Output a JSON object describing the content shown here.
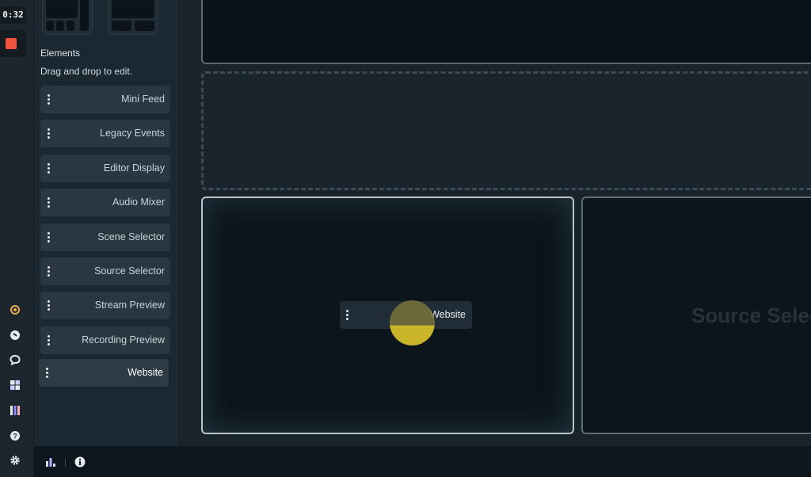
{
  "rail": {
    "timer": "0:32",
    "record_button": "stop-recording",
    "icons": [
      {
        "name": "prime-icon",
        "color": "#f0a94a"
      },
      {
        "name": "dashboard-icon",
        "color": "#e6ebf0"
      },
      {
        "name": "chat-icon",
        "color": "#e6ebf0"
      },
      {
        "name": "layout-editor-icon",
        "color": "#c8d0ff"
      },
      {
        "name": "studio-mode-icon",
        "color": "#d0c8ff"
      },
      {
        "name": "help-icon",
        "color": "#e6ebf0"
      },
      {
        "name": "settings-icon",
        "color": "#e6ebf0"
      }
    ]
  },
  "sidebar": {
    "section_title": "Elements",
    "section_subtitle": "Drag and drop to edit.",
    "items": [
      {
        "label": "Mini Feed"
      },
      {
        "label": "Legacy Events"
      },
      {
        "label": "Editor Display"
      },
      {
        "label": "Audio Mixer"
      },
      {
        "label": "Scene Selector"
      },
      {
        "label": "Source Selector"
      },
      {
        "label": "Stream Preview"
      },
      {
        "label": "Recording Preview"
      },
      {
        "label": "Website"
      }
    ]
  },
  "canvas": {
    "dragging_item": "Website",
    "right_slot_placeholder": "Source Selector"
  },
  "colors": {
    "record": "#f0543c",
    "cursor_highlight": "#c9b42a"
  }
}
